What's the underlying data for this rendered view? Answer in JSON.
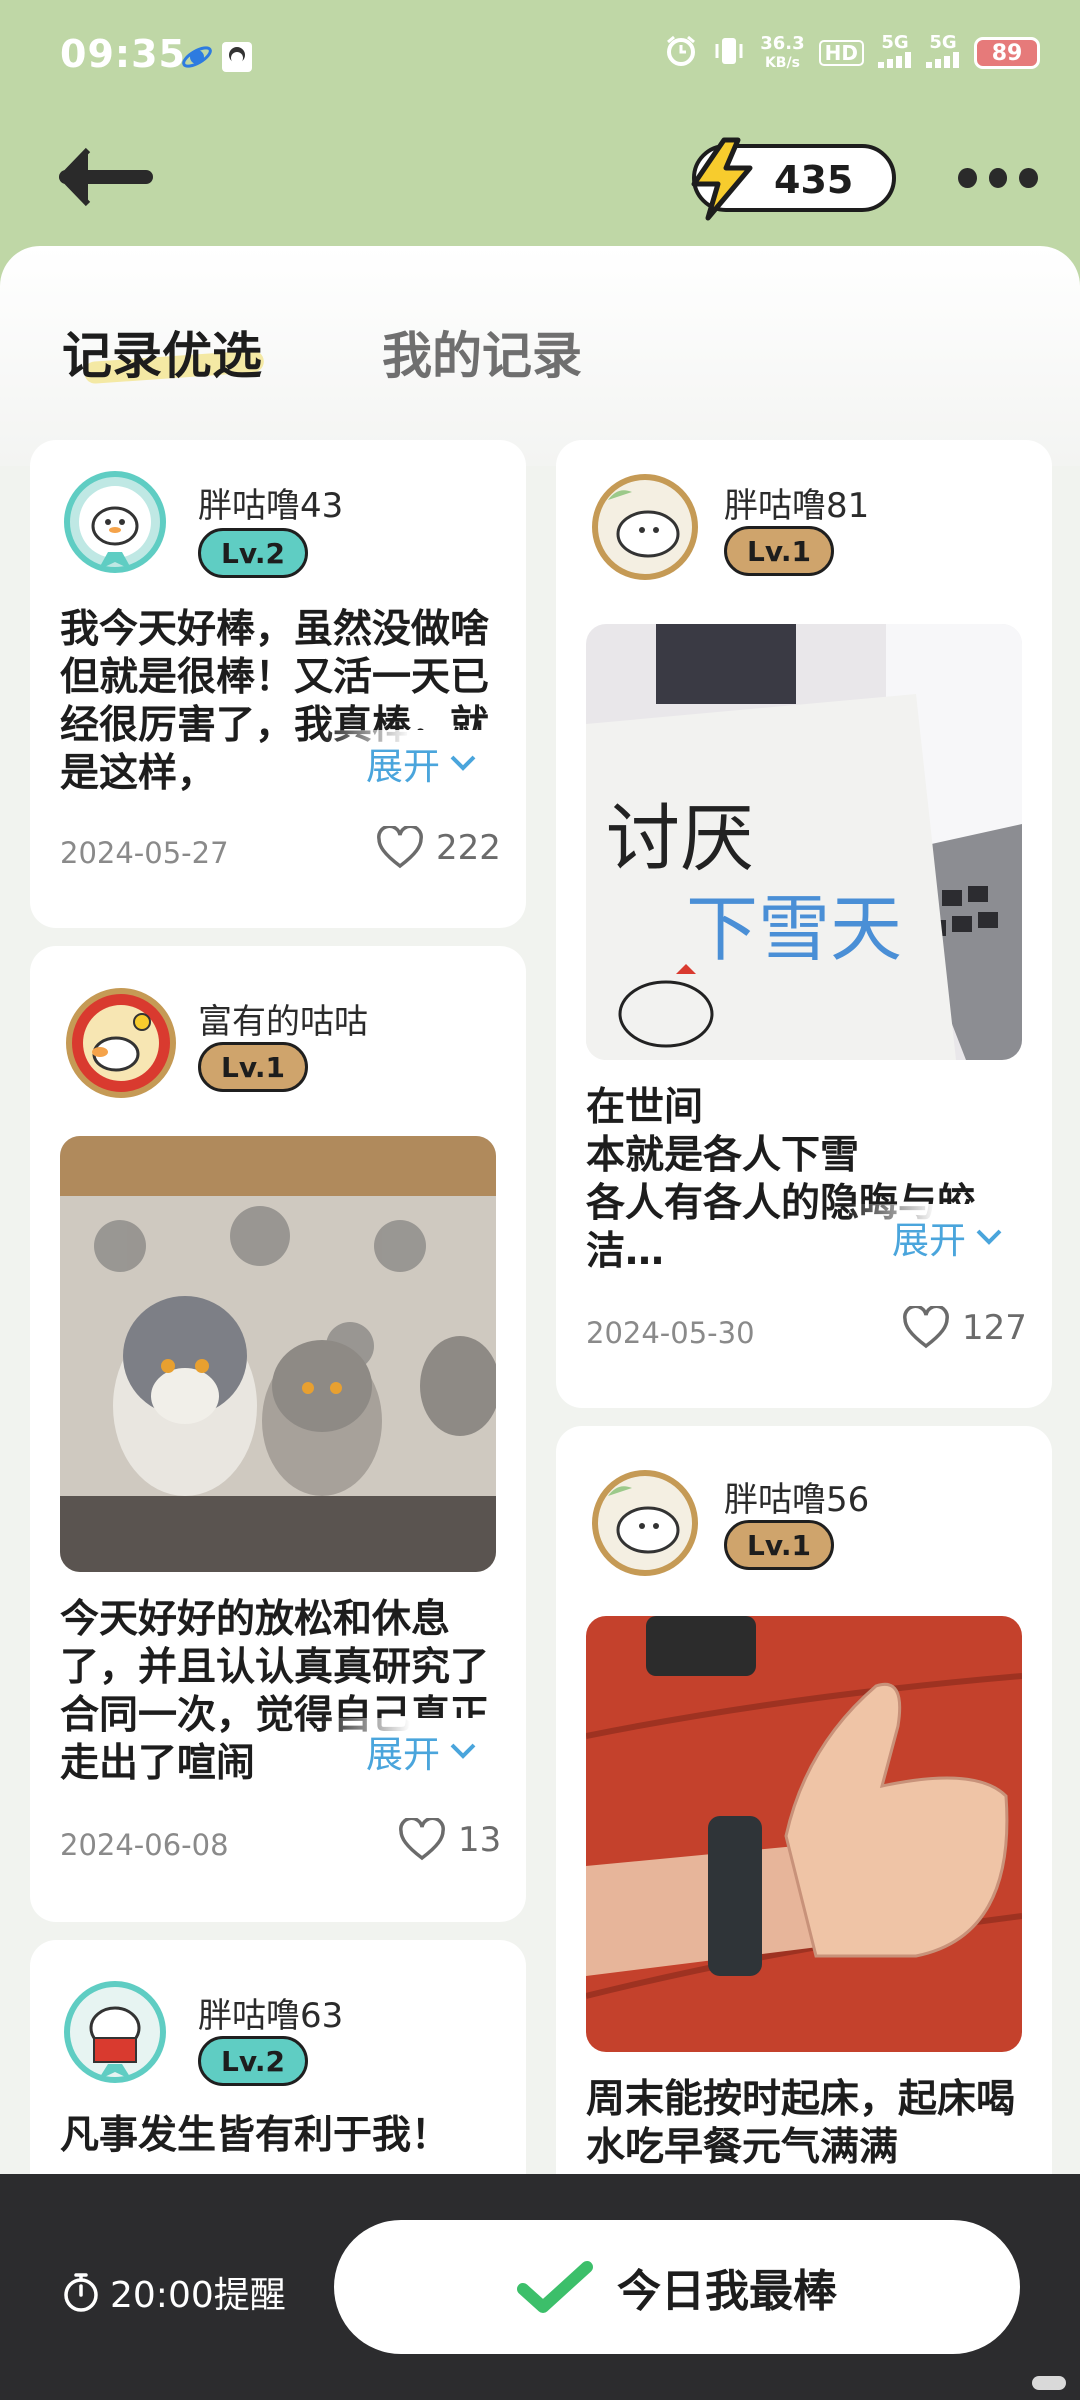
{
  "status_bar": {
    "time": "09:35",
    "network_speed_value": "36.3",
    "network_speed_unit": "KB/s",
    "hd_label": "HD",
    "signal1_label": "5G",
    "signal2_label": "5G",
    "battery": "89"
  },
  "header": {
    "energy_value": "435"
  },
  "tabs": [
    {
      "label": "记录优选",
      "active": true
    },
    {
      "label": "我的记录",
      "active": false
    }
  ],
  "posts": [
    {
      "username": "胖咕噜43",
      "level": "Lv.2",
      "text": "我今天好棒，虽然没做啥但就是很棒！又活一天已经很厉害了，我真棒，就是这样，",
      "expand_label": "展开",
      "date": "2024-05-27",
      "likes": "222"
    },
    {
      "username": "富有的咕咕",
      "level": "Lv.1",
      "text": "今天好好的放松和休息了，并且认认真真研究了合同一次，觉得自己真正走出了喧闹",
      "expand_label": "展开",
      "date": "2024-06-08",
      "likes": "13"
    },
    {
      "username": "胖咕噜63",
      "level": "Lv.2",
      "text": "凡事发生皆有利于我！"
    },
    {
      "username": "胖咕噜81",
      "level": "Lv.1",
      "photo_text_1": "讨厌",
      "photo_text_2": "下雪天",
      "text": "在世间\n本就是各人下雪\n各人有各人的隐晦与皎洁…",
      "expand_label": "展开",
      "date": "2024-05-30",
      "likes": "127"
    },
    {
      "username": "胖咕噜56",
      "level": "Lv.1",
      "text": "周末能按时起床，起床喝水吃早餐元气满满"
    }
  ],
  "bottom": {
    "reminder_label": "20:00提醒",
    "cta_label": "今日我最棒"
  },
  "colors": {
    "header_green": "#bfd7a6",
    "level2_teal": "#5fcdc3",
    "level1_tan": "#cfa46c",
    "expand_blue": "#4aa5dc",
    "bottom_bar": "#2c2c2e",
    "check_green": "#3cbf6a"
  }
}
